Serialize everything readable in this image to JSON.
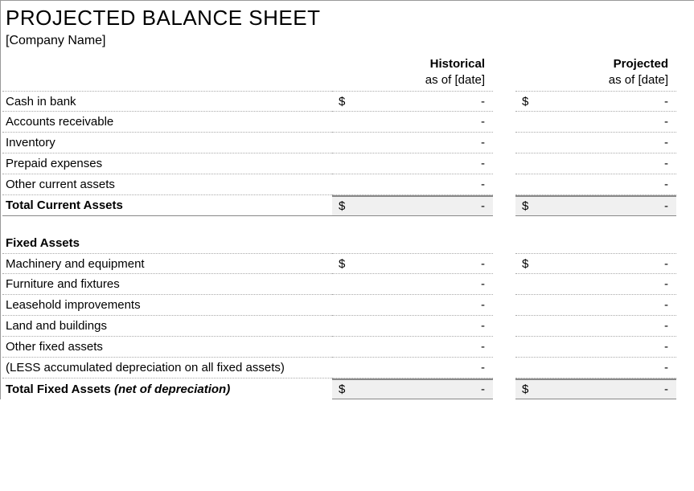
{
  "title": "PROJECTED BALANCE SHEET",
  "subtitle": "[Company Name]",
  "columns": {
    "historical": {
      "label": "Historical",
      "asof": "as of [date]"
    },
    "projected": {
      "label": "Projected",
      "asof": "as of [date]"
    }
  },
  "currentAssets": {
    "rows": [
      {
        "label": "Cash in bank",
        "hist_currency": "$",
        "hist_value": "-",
        "proj_currency": "$",
        "proj_value": "-"
      },
      {
        "label": "Accounts receivable",
        "hist_currency": "",
        "hist_value": "-",
        "proj_currency": "",
        "proj_value": "-"
      },
      {
        "label": "Inventory",
        "hist_currency": "",
        "hist_value": "-",
        "proj_currency": "",
        "proj_value": "-"
      },
      {
        "label": "Prepaid expenses",
        "hist_currency": "",
        "hist_value": "-",
        "proj_currency": "",
        "proj_value": "-"
      },
      {
        "label": "Other current assets",
        "hist_currency": "",
        "hist_value": "-",
        "proj_currency": "",
        "proj_value": "-"
      }
    ],
    "total": {
      "label": "Total Current Assets",
      "hist_currency": "$",
      "hist_value": "-",
      "proj_currency": "$",
      "proj_value": "-"
    }
  },
  "fixedAssets": {
    "heading": "Fixed Assets",
    "rows": [
      {
        "label": "Machinery and equipment",
        "hist_currency": "$",
        "hist_value": "-",
        "proj_currency": "$",
        "proj_value": "-"
      },
      {
        "label": "Furniture and fixtures",
        "hist_currency": "",
        "hist_value": "-",
        "proj_currency": "",
        "proj_value": "-"
      },
      {
        "label": "Leasehold improvements",
        "hist_currency": "",
        "hist_value": "-",
        "proj_currency": "",
        "proj_value": "-"
      },
      {
        "label": "Land and buildings",
        "hist_currency": "",
        "hist_value": "-",
        "proj_currency": "",
        "proj_value": "-"
      },
      {
        "label": "Other fixed assets",
        "hist_currency": "",
        "hist_value": "-",
        "proj_currency": "",
        "proj_value": "-"
      },
      {
        "label": "(LESS accumulated depreciation on all fixed assets)",
        "hist_currency": "",
        "hist_value": "-",
        "proj_currency": "",
        "proj_value": "-"
      }
    ],
    "total": {
      "label_main": "Total Fixed Assets ",
      "label_note": "(net of depreciation)",
      "hist_currency": "$",
      "hist_value": "-",
      "proj_currency": "$",
      "proj_value": "-"
    }
  }
}
